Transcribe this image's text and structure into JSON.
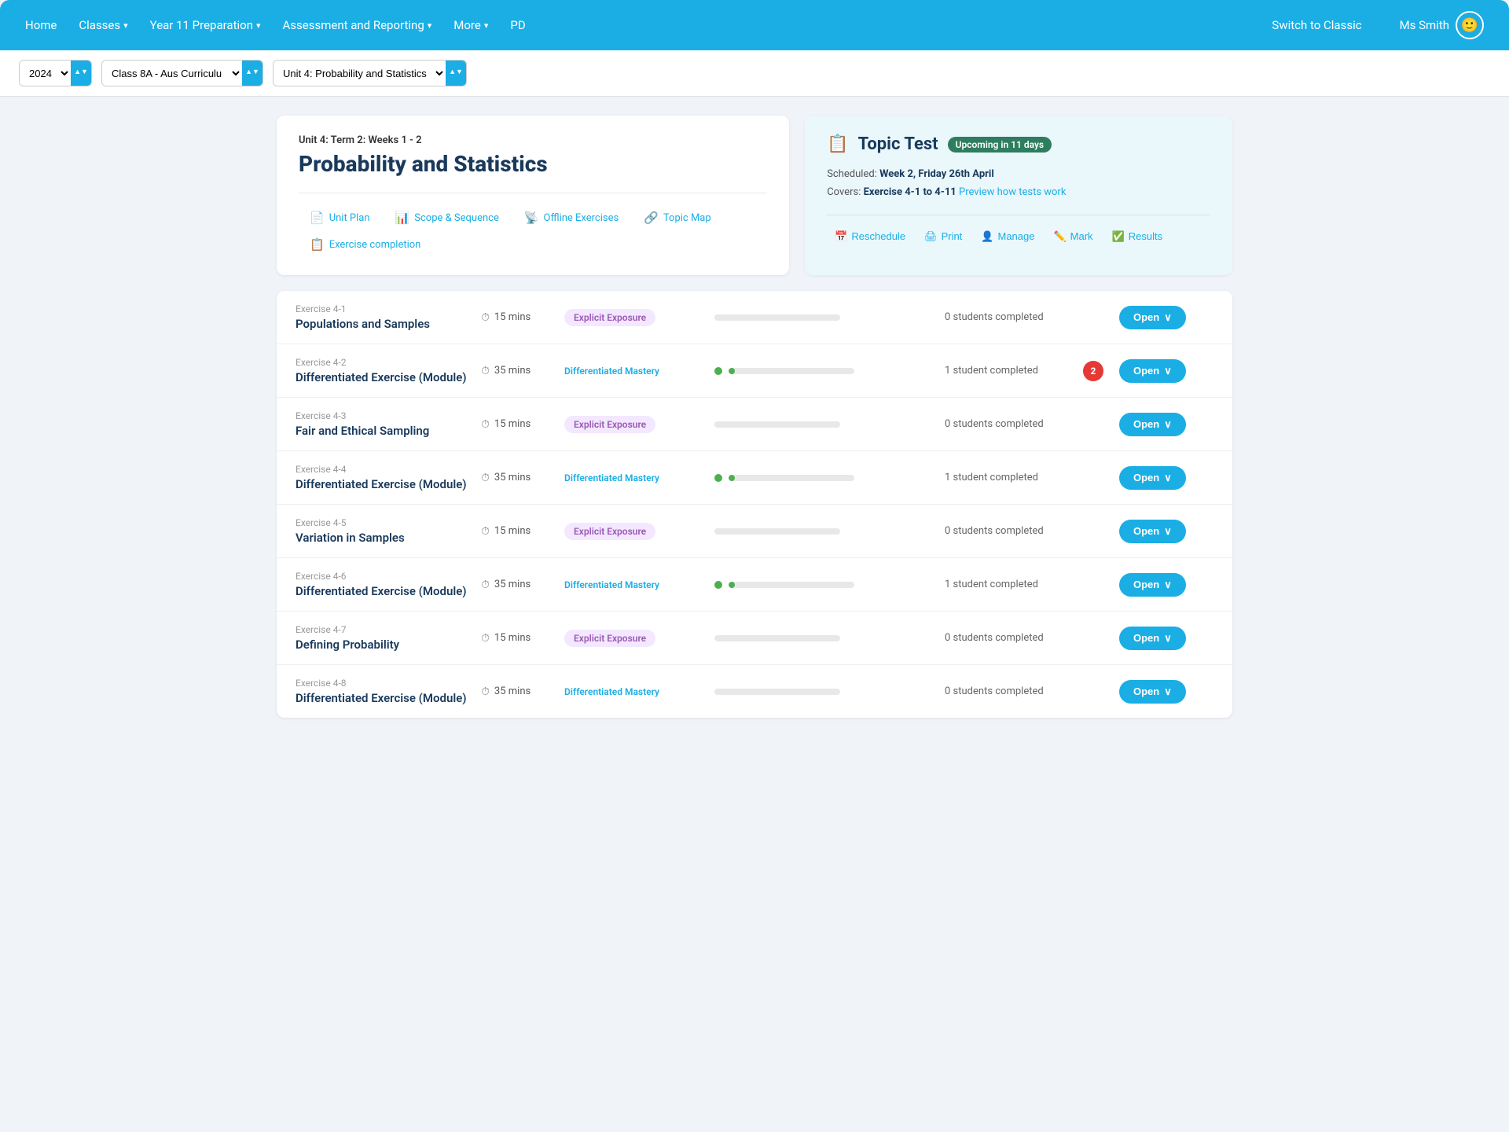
{
  "navbar": {
    "home": "Home",
    "classes": "Classes",
    "year11": "Year 11 Preparation",
    "assessment": "Assessment and Reporting",
    "more": "More",
    "pd": "PD",
    "switch_classic": "Switch to Classic",
    "user_name": "Ms Smith",
    "user_emoji": "🙂"
  },
  "toolbar": {
    "year": "2024",
    "class": "Class 8A - Aus Curriculu",
    "unit": "Unit 4: Probability and Statistics"
  },
  "unit": {
    "meta_label": "Unit 4:",
    "meta_value": "Term 2: Weeks 1 - 2",
    "title": "Probability and Statistics",
    "tabs": [
      {
        "id": "unit-plan",
        "icon": "📄",
        "label": "Unit Plan"
      },
      {
        "id": "scope-sequence",
        "icon": "📊",
        "label": "Scope & Sequence"
      },
      {
        "id": "offline-exercises",
        "icon": "📡",
        "label": "Offline Exercises"
      },
      {
        "id": "topic-map",
        "icon": "🔗",
        "label": "Topic Map"
      },
      {
        "id": "exercise-completion",
        "icon": "📋",
        "label": "Exercise completion"
      }
    ]
  },
  "topic_test": {
    "icon": "📋",
    "title": "Topic Test",
    "badge": "Upcoming in 11 days",
    "scheduled_label": "Scheduled:",
    "scheduled_value": "Week 2, Friday 26th April",
    "covers_label": "Covers:",
    "covers_value": "Exercise 4-1 to 4-11",
    "preview_link": "Preview how tests work",
    "actions": [
      {
        "id": "reschedule",
        "icon": "📅",
        "label": "Reschedule"
      },
      {
        "id": "print",
        "icon": "🖨",
        "label": "Print"
      },
      {
        "id": "manage",
        "icon": "👤",
        "label": "Manage"
      },
      {
        "id": "mark",
        "icon": "✏️",
        "label": "Mark"
      },
      {
        "id": "results",
        "icon": "✅",
        "label": "Results"
      }
    ]
  },
  "exercises": [
    {
      "num": "Exercise 4-1",
      "name": "Populations and Samples",
      "time": "15 mins",
      "type": "explicit",
      "type_label": "Explicit Exposure",
      "progress": 0,
      "has_dot": false,
      "completed": "0 students completed",
      "badge_count": null
    },
    {
      "num": "Exercise 4-2",
      "name": "Differentiated Exercise (Module)",
      "time": "35 mins",
      "type": "mastery",
      "type_label": "Differentiated Mastery",
      "progress": 5,
      "has_dot": true,
      "completed": "1 student completed",
      "badge_count": "2"
    },
    {
      "num": "Exercise 4-3",
      "name": "Fair and Ethical Sampling",
      "time": "15 mins",
      "type": "explicit",
      "type_label": "Explicit Exposure",
      "progress": 0,
      "has_dot": false,
      "completed": "0 students completed",
      "badge_count": null
    },
    {
      "num": "Exercise 4-4",
      "name": "Differentiated Exercise (Module)",
      "time": "35 mins",
      "type": "mastery",
      "type_label": "Differentiated Mastery",
      "progress": 5,
      "has_dot": true,
      "completed": "1 student completed",
      "badge_count": null
    },
    {
      "num": "Exercise 4-5",
      "name": "Variation in Samples",
      "time": "15 mins",
      "type": "explicit",
      "type_label": "Explicit Exposure",
      "progress": 0,
      "has_dot": false,
      "completed": "0 students completed",
      "badge_count": null
    },
    {
      "num": "Exercise 4-6",
      "name": "Differentiated Exercise (Module)",
      "time": "35 mins",
      "type": "mastery",
      "type_label": "Differentiated Mastery",
      "progress": 5,
      "has_dot": true,
      "completed": "1 student completed",
      "badge_count": null
    },
    {
      "num": "Exercise 4-7",
      "name": "Defining Probability",
      "time": "15 mins",
      "type": "explicit",
      "type_label": "Explicit Exposure",
      "progress": 0,
      "has_dot": false,
      "completed": "0 students completed",
      "badge_count": null
    },
    {
      "num": "Exercise 4-8",
      "name": "Differentiated Exercise (Module)",
      "time": "35 mins",
      "type": "mastery",
      "type_label": "Differentiated Mastery",
      "progress": 0,
      "has_dot": false,
      "completed": "0 students completed",
      "badge_count": null
    }
  ],
  "open_button_label": "Open",
  "open_chevron": "∨"
}
